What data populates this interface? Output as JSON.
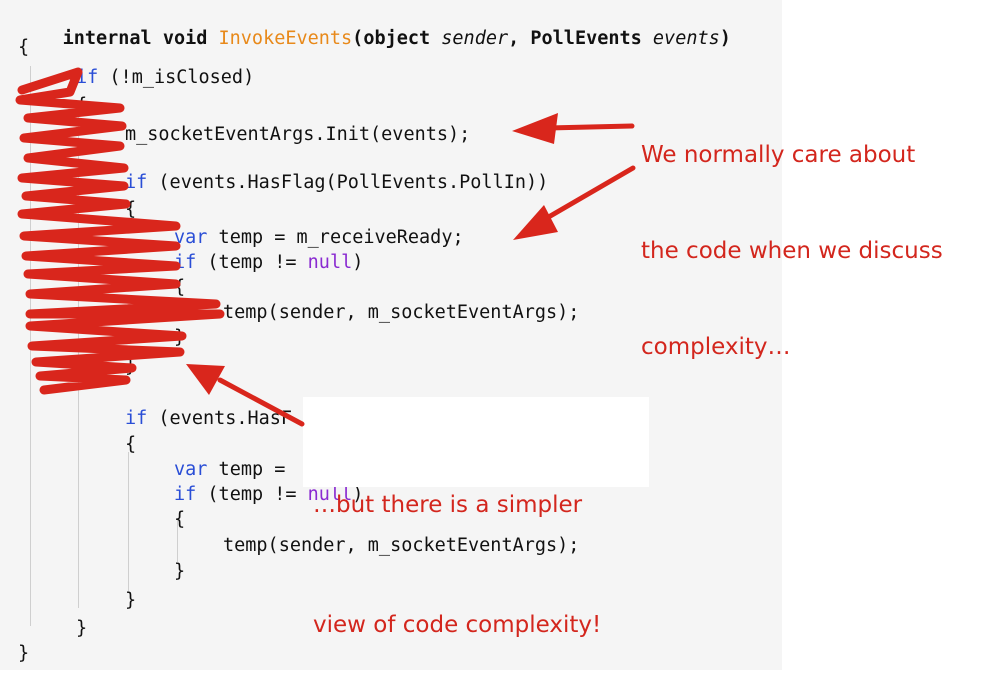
{
  "code": {
    "signature": {
      "kw1": "internal ",
      "kw2": "void ",
      "name": "InvokeEvents",
      "open": "(",
      "type1": "object ",
      "param1": "sender",
      "comma": ", ",
      "type2": "PollEvents ",
      "param2": "events",
      "close": ")"
    },
    "lines": {
      "l1": "{",
      "l2_kw": "if",
      "l2_rest": " (!m_isClosed)",
      "l3": "{",
      "l4": "m_socketEventArgs.Init(events);",
      "l5_kw": "if",
      "l5_rest": " (events.HasFlag(PollEvents.PollIn))",
      "l6": "{",
      "l7_kw": "var",
      "l7_rest": " temp = m_receiveReady;",
      "l8_kw": "if",
      "l8_rest": " (temp != ",
      "l8_null": "null",
      "l8_end": ")",
      "l9": "{",
      "l10": "temp(sender, m_socketEventArgs);",
      "l11": "}",
      "l12": "}",
      "l13_kw": "if",
      "l13_rest": " (events.HasF",
      "l14": "{",
      "l15_kw": "var",
      "l15_rest": " temp =",
      "l16_kw": "if",
      "l16_rest": " (temp != ",
      "l16_null": "null",
      "l16_end": ")",
      "l17": "{",
      "l18": "temp(sender, m_socketEventArgs);",
      "l19": "}",
      "l20": "}",
      "l21": "}",
      "l22": "}"
    }
  },
  "annotations": {
    "top": [
      "We normally care about",
      "the code when we discuss",
      "complexity…"
    ],
    "bottom": [
      "…but there is a simpler",
      "view of code complexity!"
    ]
  },
  "colors": {
    "annotation": "#d3261d",
    "scribble": "#d9261c",
    "method_name": "#e8891a",
    "keyword": "#2a4ed6",
    "null_literal": "#8a2bd1",
    "code_background": "#f5f5f5"
  }
}
